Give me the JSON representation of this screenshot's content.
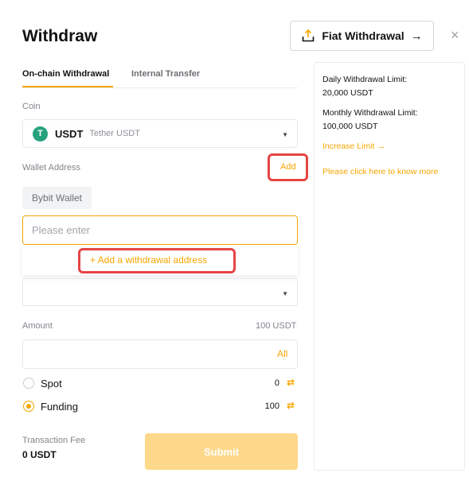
{
  "header": {
    "title": "Withdraw",
    "fiat_button": "Fiat Withdrawal",
    "fiat_arrow": "→",
    "close": "×"
  },
  "tabs": [
    {
      "label": "On-chain Withdrawal",
      "active": true
    },
    {
      "label": "Internal Transfer",
      "active": false
    }
  ],
  "coin": {
    "label": "Coin",
    "symbol": "USDT",
    "name": "Tether USDT",
    "icon": "tether-icon",
    "icon_glyph": "T"
  },
  "wallet": {
    "label": "Wallet Address",
    "add_link": "Add",
    "chip": "Bybit Wallet",
    "placeholder": "Please enter",
    "add_address": "+ Add a withdrawal address"
  },
  "amount": {
    "label": "Amount",
    "min": "100 USDT",
    "all": "All"
  },
  "accounts": [
    {
      "label": "Spot",
      "balance": "0",
      "selected": false
    },
    {
      "label": "Funding",
      "balance": "100",
      "selected": true
    }
  ],
  "fee": {
    "label": "Transaction Fee",
    "value": "0 USDT"
  },
  "submit": "Submit",
  "side": {
    "daily_label": "Daily Withdrawal Limit:",
    "daily_value": "20,000 USDT",
    "monthly_label": "Monthly Withdrawal Limit:",
    "monthly_value": "100,000 USDT",
    "increase": "Increase Limit →",
    "help": "Please click here to know more"
  },
  "colors": {
    "accent": "#f7a600",
    "highlight": "#e64545",
    "tether": "#26a17b",
    "submit_disabled": "#fdd88a"
  }
}
